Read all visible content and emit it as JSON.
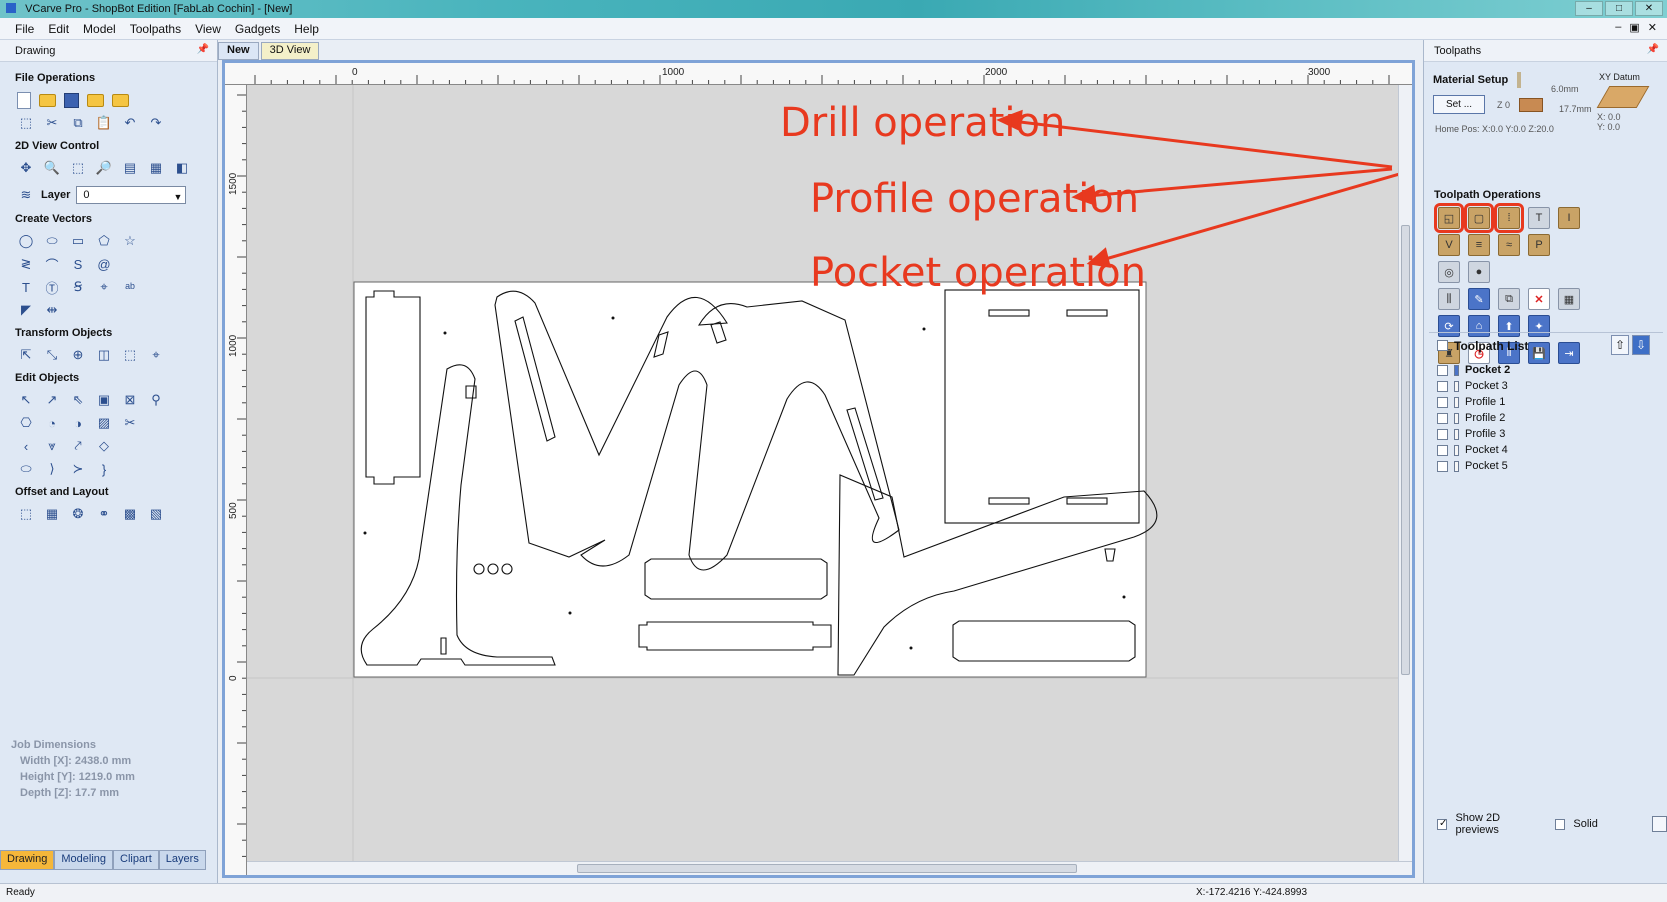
{
  "window": {
    "title": "VCarve Pro - ShopBot Edition [FabLab Cochin] - [New]",
    "buttons": [
      "–",
      "□",
      "✕"
    ]
  },
  "menu": [
    "File",
    "Edit",
    "Model",
    "Toolpaths",
    "View",
    "Gadgets",
    "Help"
  ],
  "mdi_buttons": [
    "–",
    "▣",
    "✕"
  ],
  "left_panel": {
    "title": "Drawing",
    "sections": {
      "file_ops": "File Operations",
      "view_ctrl": "2D View Control",
      "create_vectors": "Create Vectors",
      "transform": "Transform Objects",
      "edit_objects": "Edit Objects",
      "offset_layout": "Offset and Layout"
    },
    "layer_label": "Layer",
    "layer_value": "0",
    "job_dimensions": {
      "title": "Job Dimensions",
      "width": "Width  [X]: 2438.0 mm",
      "height": "Height [Y]: 1219.0 mm",
      "depth": "Depth  [Z]: 17.7 mm"
    },
    "tabs": [
      "Drawing",
      "Modeling",
      "Clipart",
      "Layers"
    ]
  },
  "doc_tabs": [
    "New",
    "3D View"
  ],
  "rulers": {
    "h_ticks": [
      "0",
      "1000",
      "2000",
      "3000"
    ],
    "v_ticks": [
      "1500",
      "1000",
      "500",
      "0"
    ]
  },
  "annotations": {
    "drill": "Drill operation",
    "profile": "Profile operation",
    "pocket": "Pocket operation",
    "color": "#e8391f"
  },
  "right_panel": {
    "title": "Toolpaths",
    "material_setup": "Material Setup",
    "set_button": "Set ...",
    "z0": "Z 0",
    "top_thick": "6.0mm",
    "material_thick": "17.7mm",
    "home_pos": "Home Pos:  X:0.0 Y:0.0 Z:20.0",
    "xy_datum": "XY Datum",
    "datum_x": "X: 0.0",
    "datum_y": "Y: 0.0",
    "toolpath_ops": "Toolpath Operations",
    "toolpath_list_title": "Toolpath List",
    "toolpaths": [
      "Pocket 2",
      "Pocket 3",
      "Profile 1",
      "Profile 2",
      "Profile 3",
      "Pocket 4",
      "Pocket 5"
    ],
    "show_previews": "Show 2D previews",
    "solid": "Solid"
  },
  "status": {
    "left": "Ready",
    "coords": "X:-172.4216 Y:-424.8993"
  }
}
